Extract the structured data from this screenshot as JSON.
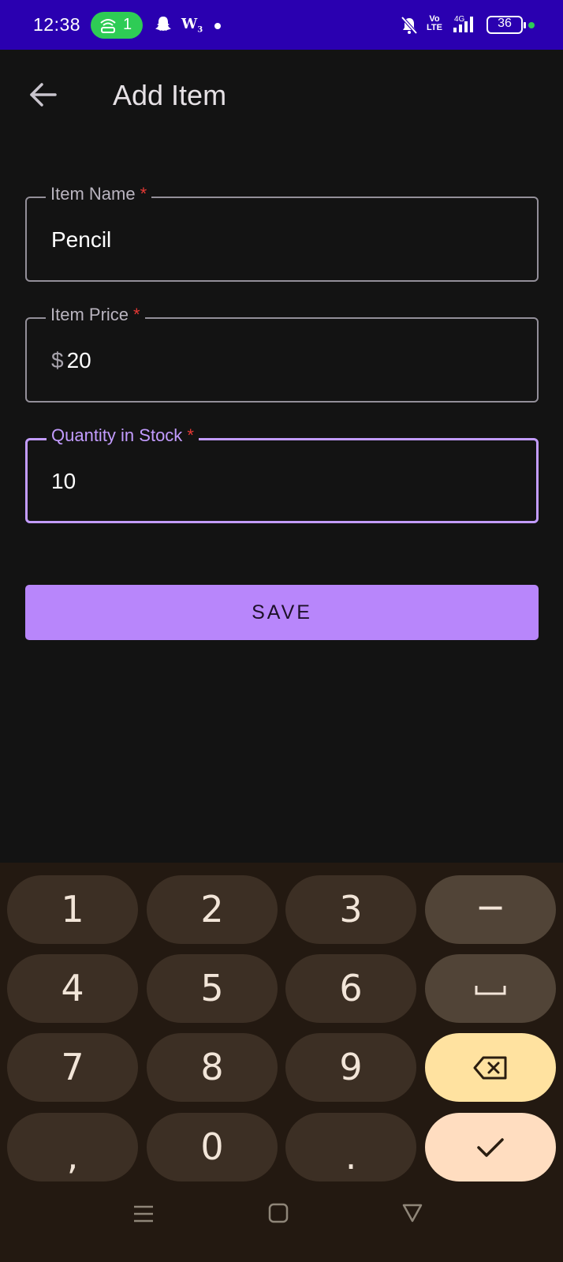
{
  "status_bar": {
    "time": "12:38",
    "hotspot_count": "1",
    "battery": "36",
    "volte": [
      "Vo",
      "LTE"
    ],
    "network": "4G",
    "colors": {
      "background": "#2a00b0",
      "hotspot": "#2ecc55"
    }
  },
  "app_bar": {
    "back_icon": "arrow-back-icon",
    "title": "Add Item"
  },
  "form": {
    "item_name": {
      "label": "Item Name",
      "required_mark": "*",
      "value": "Pencil"
    },
    "item_price": {
      "label": "Item Price",
      "required_mark": "*",
      "prefix": "$",
      "value": "20"
    },
    "quantity": {
      "label": "Quantity in Stock",
      "required_mark": "*",
      "value": "10",
      "focused": true
    },
    "save_label": "SAVE",
    "accent_color": "#c39cff"
  },
  "keyboard": {
    "rows": [
      [
        "1",
        "2",
        "3",
        "-"
      ],
      [
        "4",
        "5",
        "6",
        "space-icon"
      ],
      [
        "7",
        "8",
        "9",
        "backspace-icon"
      ],
      [
        ",",
        "0",
        ".",
        "check-icon"
      ]
    ],
    "k1": "1",
    "k2": "2",
    "k3": "3",
    "k_minus": "−",
    "k4": "4",
    "k5": "5",
    "k6": "6",
    "k7": "7",
    "k8": "8",
    "k9": "9",
    "k_comma": ",",
    "k0": "0",
    "k_period": "."
  },
  "nav_bar": {
    "icons": [
      "menu-icon",
      "home-icon",
      "back-icon"
    ]
  }
}
